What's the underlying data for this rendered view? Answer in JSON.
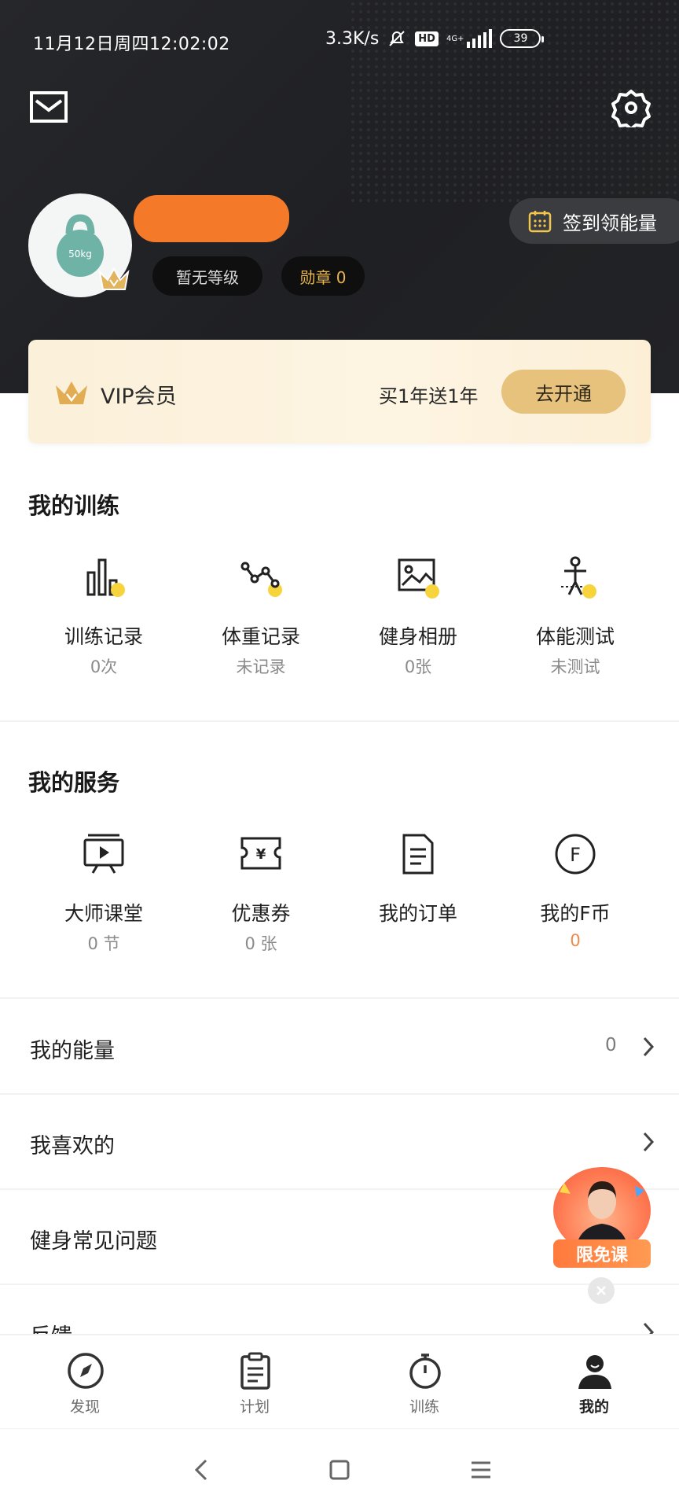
{
  "status_bar": {
    "time": "11月12日周四12:02:02",
    "speed": "3.3K/s",
    "hd": "HD",
    "network": "4G+",
    "battery": "39"
  },
  "profile": {
    "level": "暂无等级",
    "medal": "勋章 0",
    "avatar_text": "50kg",
    "checkin": "签到领能量"
  },
  "vip": {
    "title": "VIP会员",
    "promo": "买1年送1年",
    "button": "去开通"
  },
  "training": {
    "title": "我的训练",
    "items": [
      {
        "label": "训练记录",
        "sub": "0次",
        "icon": "bar-chart-icon"
      },
      {
        "label": "体重记录",
        "sub": "未记录",
        "icon": "weight-trend-icon"
      },
      {
        "label": "健身相册",
        "sub": "0张",
        "icon": "photo-icon"
      },
      {
        "label": "体能测试",
        "sub": "未测试",
        "icon": "fitness-test-icon"
      }
    ]
  },
  "services": {
    "title": "我的服务",
    "items": [
      {
        "label": "大师课堂",
        "sub": "0 节",
        "icon": "video-class-icon"
      },
      {
        "label": "优惠券",
        "sub": "0 张",
        "icon": "coupon-icon"
      },
      {
        "label": "我的订单",
        "sub": "",
        "icon": "order-icon"
      },
      {
        "label": "我的F币",
        "sub": "0",
        "icon": "f-coin-icon"
      }
    ]
  },
  "list": {
    "energy": {
      "label": "我的能量",
      "value": "0"
    },
    "liked": {
      "label": "我喜欢的"
    },
    "faq": {
      "label": "健身常见问题"
    },
    "feedback": {
      "label": "反馈"
    }
  },
  "promo_float": {
    "tag": "限免课"
  },
  "tabs": [
    {
      "label": "发现",
      "icon": "compass-icon"
    },
    {
      "label": "计划",
      "icon": "clipboard-icon"
    },
    {
      "label": "训练",
      "icon": "stopwatch-icon"
    },
    {
      "label": "我的",
      "icon": "person-icon"
    }
  ],
  "colors": {
    "header_bg": "#222326",
    "accent_yellow": "#f7d43c",
    "vip_gold": "#e6c27c",
    "orange": "#f08a4b"
  }
}
